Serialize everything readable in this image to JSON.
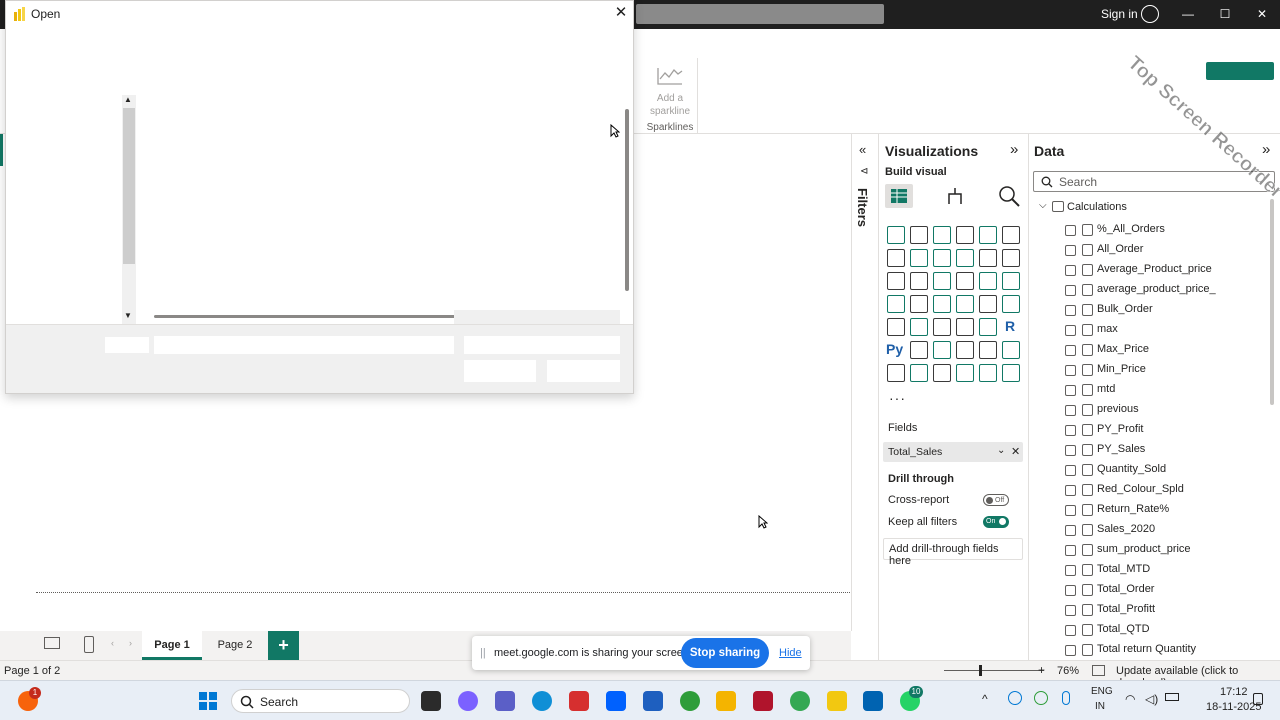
{
  "titlebar": {
    "signin_label": "Sign in"
  },
  "ribbon": {
    "sparkline_label": "Add a sparkline",
    "sparklines_group": "Sparklines"
  },
  "dialog": {
    "title": "Open",
    "close_icon": "close-icon"
  },
  "filters": {
    "label": "Filters"
  },
  "visualizations": {
    "title": "Visualizations",
    "build_visual": "Build visual",
    "more": "···",
    "fields_label": "Fields",
    "field_value": "Total_Sales",
    "drill_through": "Drill through",
    "cross_report": "Cross-report",
    "cross_report_state": "Off",
    "keep_all_filters": "Keep all filters",
    "keep_all_filters_state": "On",
    "add_drill": "Add drill-through fields here"
  },
  "data_pane": {
    "title": "Data",
    "search_placeholder": "Search",
    "table_name": "Calculations",
    "fields": [
      "%_All_Orders",
      "All_Order",
      "Average_Product_price",
      "average_product_price_",
      "Bulk_Order",
      "max",
      "Max_Price",
      "Min_Price",
      "mtd",
      "previous",
      "PY_Profit",
      "PY_Sales",
      "Quantity_Sold",
      "Red_Colour_Spld",
      "Return_Rate%",
      "Sales_2020",
      "sum_product_price",
      "Total_MTD",
      "Total_Order",
      "Total_Profitt",
      "Total_QTD",
      "Total return Quantity"
    ]
  },
  "pages": {
    "tab1": "Page 1",
    "tab2": "Page 2",
    "add": "+"
  },
  "statusbar": {
    "page_count": "Page 1 of 2",
    "zoom": "76%",
    "update": "Update available (click to download)"
  },
  "sharing": {
    "message": "meet.google.com is sharing your screen.",
    "stop": "Stop sharing",
    "hide": "Hide"
  },
  "taskbar": {
    "search": "Search",
    "lang_top": "ENG",
    "lang_bottom": "IN",
    "time": "17:12",
    "date": "18-11-2025",
    "notification_count": "1",
    "whatsapp_count": "10"
  },
  "watermark": "Top Screen Recorder",
  "colors": {
    "accent": "#117865",
    "share_blue": "#1a73e8"
  }
}
